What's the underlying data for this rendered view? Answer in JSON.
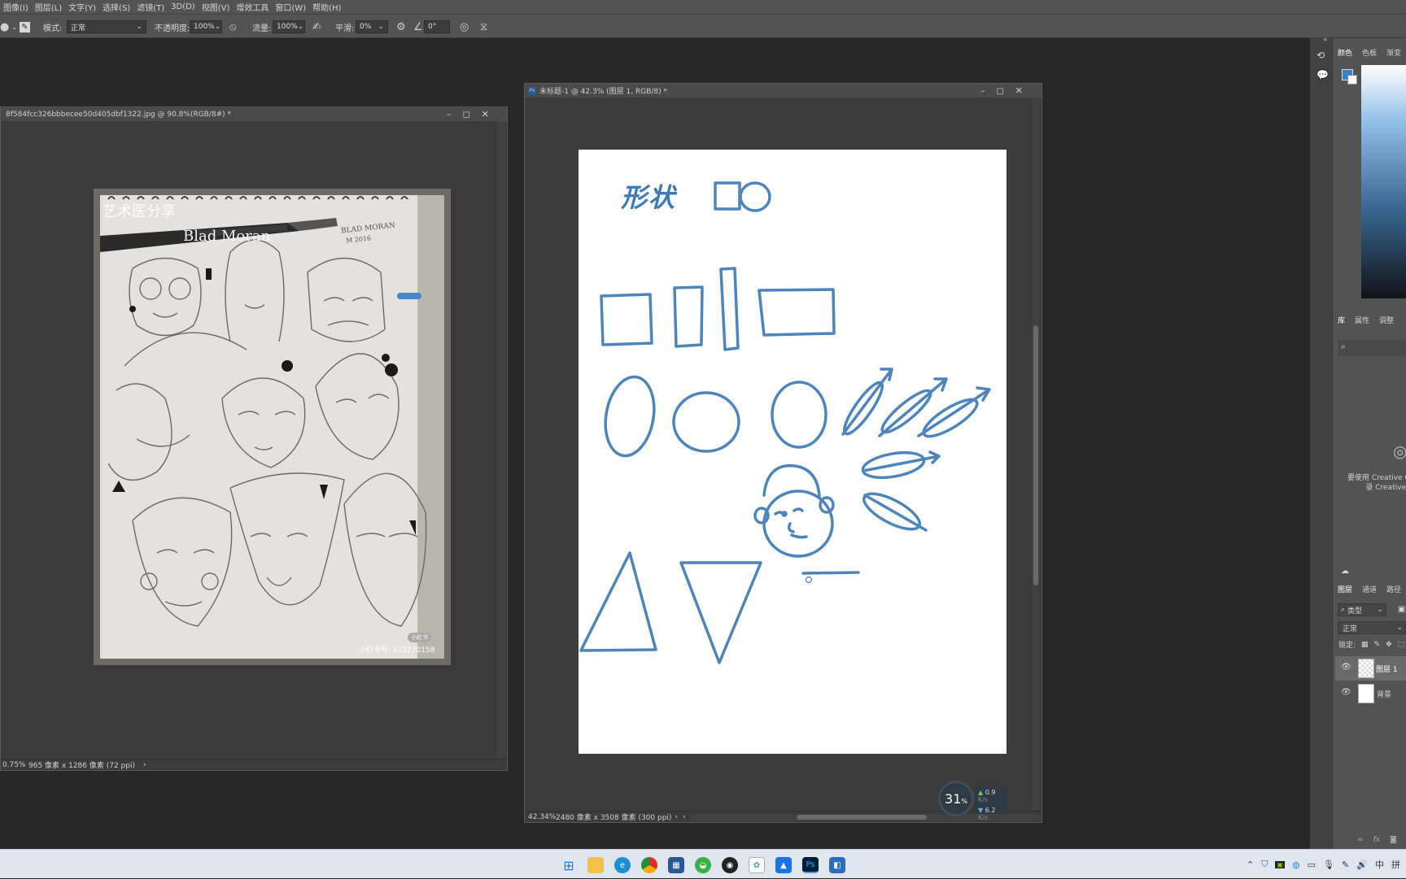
{
  "menu": [
    "图像(I)",
    "图层(L)",
    "文字(Y)",
    "选择(S)",
    "滤镜(T)",
    "3D(D)",
    "视图(V)",
    "增效工具",
    "窗口(W)",
    "帮助(H)"
  ],
  "options": {
    "mode_label": "模式:",
    "mode_value": "正常",
    "opacity_label": "不透明度:",
    "opacity_value": "100%",
    "flow_label": "流量:",
    "flow_value": "100%",
    "smooth_label": "平滑:",
    "smooth_value": "0%",
    "angle_value": "0°"
  },
  "doc1": {
    "title": "8f584fcc326bbbecee50d405dbf1322.jpg @ 90.8%(RGB/8#) *",
    "zoom": "0.75%",
    "size": "965 像素 x 1286 像素 (72 ppi)",
    "photo_overlay_1": "艺术医分享",
    "photo_overlay_2": "Blad Moran",
    "photo_signature": "BLAD MORAN",
    "photo_signature_year": "M 2016",
    "photo_badge": "小红书",
    "photo_caption": "小红书号: 411270158"
  },
  "doc2": {
    "title": "未标题-1 @ 42.3% (图层 1, RGB/8) *",
    "zoom": "42.34%",
    "size": "2480 像素 x 3508 像素 (300 ppi)",
    "sketch_title": "形状"
  },
  "netmeter": {
    "percent": "31",
    "unit": "%",
    "up": "0.9",
    "down": "6.2",
    "rate_unit": "K/s"
  },
  "panels": {
    "color_tabs": [
      "颜色",
      "色板",
      "渐变"
    ],
    "lib_tabs": [
      "库",
      "属性",
      "调整"
    ],
    "lib_notice_1": "要使用 Creative C",
    "lib_notice_2": "录 Creative",
    "layer_tabs": [
      "图层",
      "通道",
      "路径"
    ],
    "layer_filter": "类型",
    "blend_mode": "正常",
    "lock_label": "锁定:",
    "layers": [
      {
        "name": "图层 1"
      },
      {
        "name": "背景"
      }
    ]
  },
  "tray": {
    "ime_1": "中",
    "ime_2": "拼"
  }
}
